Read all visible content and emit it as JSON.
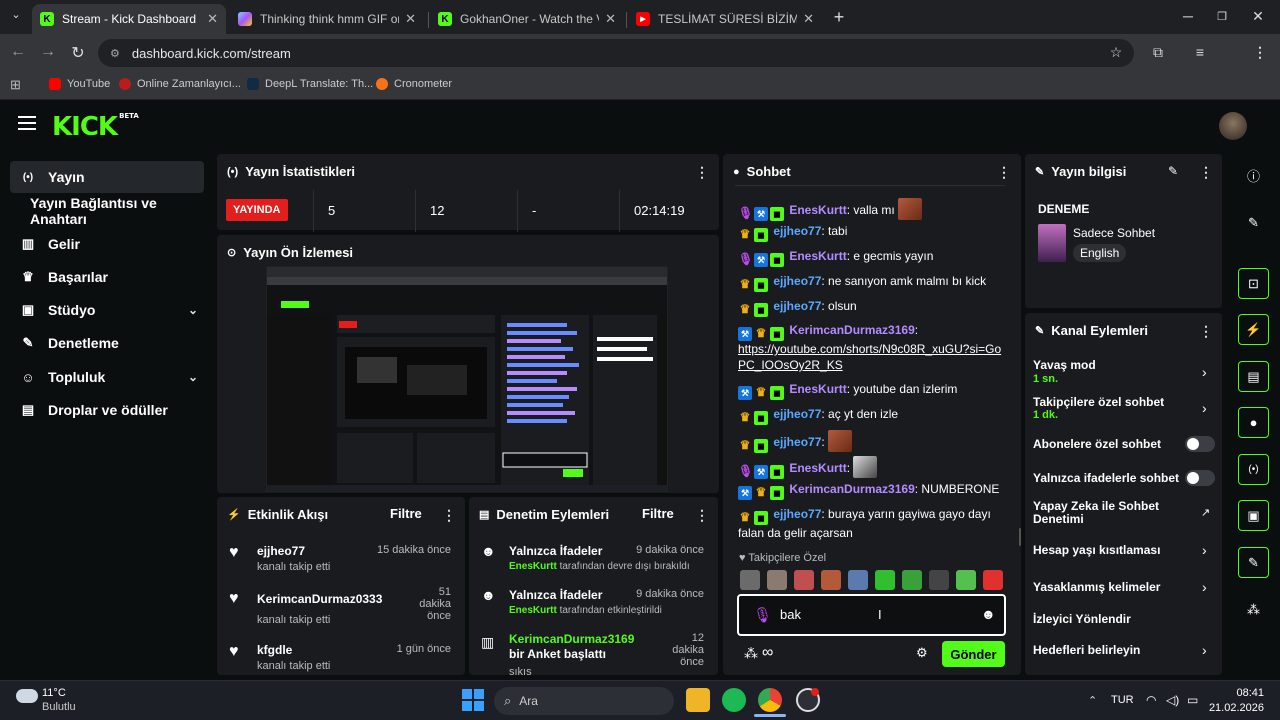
{
  "browser": {
    "tabs": [
      {
        "title": "Stream - Kick Dashboard",
        "favicon_color": "#53fc18",
        "favicon_text": "K",
        "active": true
      },
      {
        "title": "Thinking think hmm GIF on GIF",
        "favicon_color": "#7dd3fc",
        "favicon_text": "",
        "active": false
      },
      {
        "title": "GokhanOner - Watch the VOD",
        "favicon_color": "#53fc18",
        "favicon_text": "K",
        "active": false
      },
      {
        "title": "TESLİMAT SÜRESİ BİZİM İÇİN Ç",
        "favicon_color": "#ff0000",
        "favicon_text": "▶",
        "active": false
      }
    ],
    "url": "dashboard.kick.com/stream",
    "bookmarks": [
      {
        "label": "YouTube",
        "color": "#ff0000"
      },
      {
        "label": "Online Zamanlayıcı...",
        "color": "#b91c1c"
      },
      {
        "label": "DeepL Translate: Th...",
        "color": "#0f2b46"
      },
      {
        "label": "Cronometer",
        "color": "#f97316"
      }
    ]
  },
  "kick": {
    "logo": "KICK",
    "logo_badge": "BETA",
    "accent": "#53fc18",
    "sidebar": [
      {
        "label": "Yayın",
        "icon": "broadcast-icon",
        "glyph": "((•))",
        "active": true,
        "chevron": false
      },
      {
        "label": "Yayın Bağlantısı ve Anahtarı",
        "icon": "",
        "glyph": "",
        "active": false,
        "chevron": false
      },
      {
        "label": "Gelir",
        "icon": "chart-icon",
        "glyph": "▮▮",
        "active": false,
        "chevron": false
      },
      {
        "label": "Başarılar",
        "icon": "trophy-icon",
        "glyph": "🏆",
        "active": false,
        "chevron": false
      },
      {
        "label": "Stüdyo",
        "icon": "studio-icon",
        "glyph": "▣",
        "active": false,
        "chevron": true
      },
      {
        "label": "Denetleme",
        "icon": "wrench-icon",
        "glyph": "🔧",
        "active": false,
        "chevron": false
      },
      {
        "label": "Topluluk",
        "icon": "community-icon",
        "glyph": "👥",
        "active": false,
        "chevron": true
      },
      {
        "label": "Droplar ve ödüller",
        "icon": "gift-icon",
        "glyph": "🎁",
        "active": false,
        "chevron": false
      }
    ],
    "stats": {
      "title": "Yayın İstatistikleri",
      "live_label": "YAYINDA",
      "values": [
        "5",
        "12",
        "-",
        "02:14:19"
      ]
    },
    "preview": {
      "title": "Yayın Ön İzlemesi"
    },
    "activity": {
      "title": "Etkinlik Akışı",
      "filter": "Filtre",
      "items": [
        {
          "name": "ejjheo77",
          "sub": "kanalı takip etti",
          "time": "15 dakika önce"
        },
        {
          "name": "KerimcanDurmaz0333",
          "sub": "kanalı takip etti",
          "time": "51 dakika önce"
        },
        {
          "name": "kfgdle",
          "sub": "kanalı takip etti",
          "time": "1 gün önce"
        }
      ]
    },
    "moderation": {
      "title": "Denetim Eylemleri",
      "filter": "Filtre",
      "items": [
        {
          "title": "Yalnızca İfadeler",
          "actor": "EnesKurtt",
          "desc": "tarafından devre dışı bırakıldı",
          "time": "9 dakika önce"
        },
        {
          "title": "Yalnızca İfadeler",
          "actor": "EnesKurtt",
          "desc": "tarafından etkinleştirildi",
          "time": "9 dakika önce"
        },
        {
          "title_green": "KerimcanDurmaz3169",
          "title_rest": "bir Anket başlattı",
          "time": "12 dakika önce",
          "desc": "sıkıs"
        }
      ]
    },
    "chat": {
      "title": "Sohbet",
      "messages": [
        {
          "badges": [
            "mic",
            "hammer",
            "green"
          ],
          "user": "EnesKurtt",
          "color": "#b58cff",
          "text": "valla mı",
          "emote": true
        },
        {
          "badges": [
            "crown",
            "green"
          ],
          "user": "ejjheo77",
          "color": "#5aa9ff",
          "text": "tabi",
          "emote": false
        },
        {
          "badges": [
            "mic",
            "hammer",
            "green"
          ],
          "user": "EnesKurtt",
          "color": "#b58cff",
          "text": "e gecmis yayın",
          "emote": false
        },
        {
          "badges": [
            "crown",
            "green"
          ],
          "user": "ejjheo77",
          "color": "#5aa9ff",
          "text": "ne sanıyon amk malmı bı kick",
          "emote": false
        },
        {
          "badges": [
            "crown",
            "green"
          ],
          "user": "ejjheo77",
          "color": "#5aa9ff",
          "text": "olsun",
          "emote": false
        },
        {
          "badges": [
            "hammer",
            "crown",
            "green"
          ],
          "user": "KerimcanDurmaz3169",
          "color": "#b58cff",
          "text": "",
          "link": "https://youtube.com/shorts/N9c08R_xuGU?si=GoPC_IOOsOy2R_KS",
          "emote": false
        },
        {
          "badges": [
            "hammer",
            "crown",
            "green"
          ],
          "user": "EnesKurtt",
          "color": "#b58cff",
          "text": "youtube dan izlerim",
          "emote": false
        },
        {
          "badges": [
            "crown",
            "green"
          ],
          "user": "ejjheo77",
          "color": "#5aa9ff",
          "text": "aç yt den izle",
          "emote": false
        },
        {
          "badges": [
            "crown",
            "green"
          ],
          "user": "ejjheo77",
          "color": "#5aa9ff",
          "text": "",
          "emote": true
        },
        {
          "badges": [
            "mic",
            "hammer",
            "green"
          ],
          "user": "EnesKurtt",
          "color": "#b58cff",
          "text": "",
          "emote": true
        },
        {
          "badges": [
            "hammer",
            "crown",
            "green"
          ],
          "user": "KerimcanDurmaz3169",
          "color": "#b58cff",
          "text": "NUMBERONE",
          "emote": false
        },
        {
          "badges": [
            "crown",
            "green"
          ],
          "user": "ejjheo77",
          "color": "#5aa9ff",
          "text": "buraya yarın gayiwa gayo dayı falan da gelir açarsan",
          "emote": false
        }
      ],
      "followers_only": "Takipçilere Özel",
      "input_value": "bak",
      "send_label": "Gönder"
    },
    "stream_info": {
      "title": "Yayın bilgisi",
      "stream_title": "DENEME",
      "category": "Sadece Sohbet",
      "language": "English"
    },
    "channel_actions": {
      "title": "Kanal Eylemleri",
      "items": [
        {
          "label": "Yavaş mod",
          "sub": "1 sn.",
          "control": "chevron"
        },
        {
          "label": "Takipçilere özel sohbet",
          "sub": "1 dk.",
          "control": "chevron"
        },
        {
          "label": "Abonelere özel sohbet",
          "sub": "",
          "control": "toggle"
        },
        {
          "label": "Yalnızca ifadelerle sohbet",
          "sub": "",
          "control": "toggle"
        },
        {
          "label": "Yapay Zeka ile Sohbet Denetimi",
          "sub": "",
          "control": "external"
        },
        {
          "label": "Hesap yaşı kısıtlaması",
          "sub": "",
          "control": "chevron"
        },
        {
          "label": "Yasaklanmış kelimeler",
          "sub": "",
          "control": "chevron"
        },
        {
          "label": "İzleyici Yönlendir",
          "sub": "",
          "control": "none"
        },
        {
          "label": "Hedefleri belirleyin",
          "sub": "",
          "control": "chevron"
        }
      ]
    }
  },
  "taskbar": {
    "weather_temp": "11°C",
    "weather_desc": "Bulutlu",
    "search_placeholder": "Ara",
    "language": "TUR",
    "time": "08:41",
    "date": "21.02.2026"
  }
}
